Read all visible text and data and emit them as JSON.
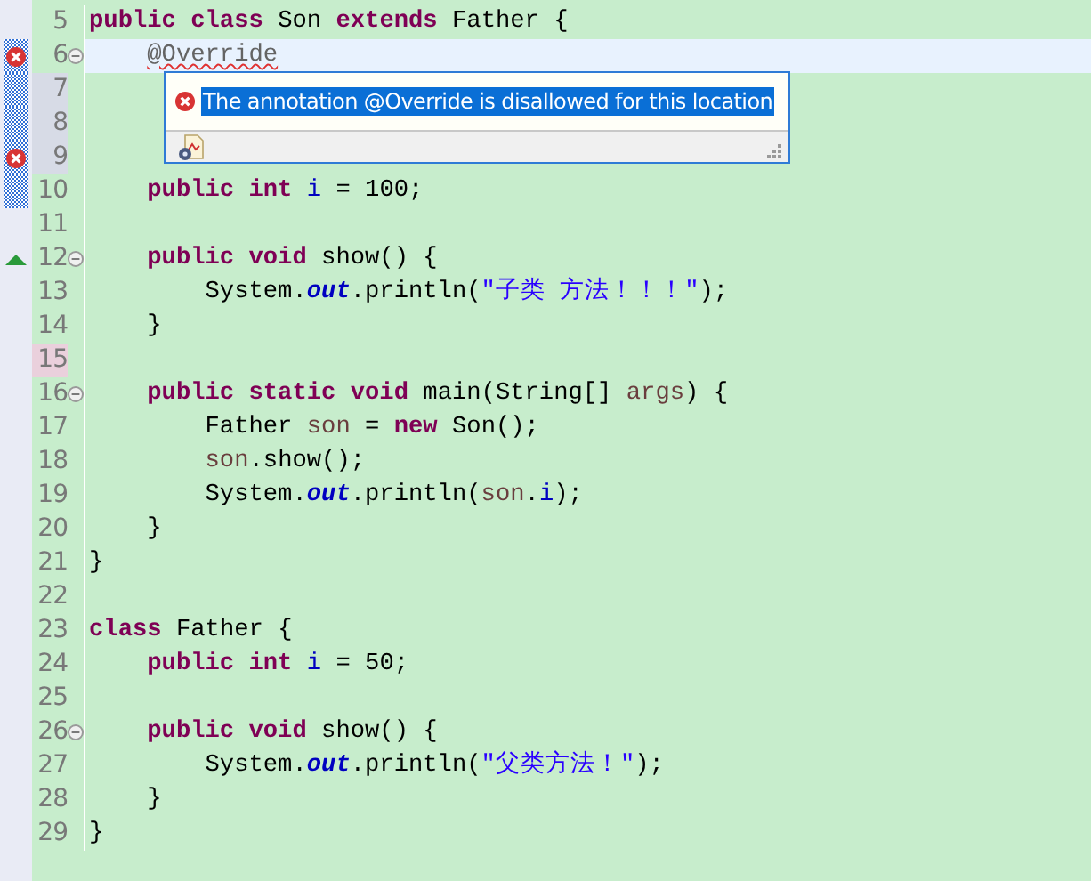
{
  "lines": [
    {
      "number": "5",
      "fold": false,
      "range": false,
      "current": false,
      "error": false,
      "override": false,
      "changed": false,
      "occurrence": false,
      "tokens": [
        {
          "kind": "kw",
          "text": "public class"
        },
        {
          "kind": "plain",
          "text": " Son "
        },
        {
          "kind": "kw",
          "text": "extends"
        },
        {
          "kind": "plain",
          "text": " Father {"
        }
      ]
    },
    {
      "number": "6",
      "fold": true,
      "range": true,
      "current": true,
      "error": true,
      "override": false,
      "changed": false,
      "occurrence": false,
      "tokens": [
        {
          "kind": "error",
          "text": "    @Override"
        }
      ]
    },
    {
      "number": "7",
      "fold": false,
      "range": true,
      "current": false,
      "error": false,
      "override": false,
      "changed": true,
      "occurrence": false
    },
    {
      "number": "8",
      "fold": false,
      "range": true,
      "current": false,
      "error": false,
      "override": false,
      "changed": true,
      "occurrence": false
    },
    {
      "number": "9",
      "fold": false,
      "range": true,
      "current": false,
      "error": true,
      "override": false,
      "changed": true,
      "occurrence": false
    },
    {
      "number": "10",
      "fold": false,
      "range": true,
      "current": false,
      "error": false,
      "override": false,
      "changed": false,
      "occurrence": false,
      "tokens": [
        {
          "kind": "kw",
          "text": "    public int"
        },
        {
          "kind": "field",
          "text": " i"
        },
        {
          "kind": "plain",
          "text": " = 100;"
        }
      ]
    },
    {
      "number": "11",
      "fold": false,
      "range": false,
      "current": false,
      "error": false,
      "override": false,
      "changed": false,
      "occurrence": false
    },
    {
      "number": "12",
      "fold": true,
      "range": false,
      "current": false,
      "error": false,
      "override": true,
      "changed": false,
      "occurrence": false,
      "tokens": [
        {
          "kind": "kw",
          "text": "    public void"
        },
        {
          "kind": "plain",
          "text": " show() {"
        }
      ]
    },
    {
      "number": "13",
      "fold": false,
      "range": false,
      "current": false,
      "error": false,
      "override": false,
      "changed": false,
      "occurrence": false,
      "tokens": [
        {
          "kind": "plain",
          "text": "        System."
        },
        {
          "kind": "static",
          "text": "out"
        },
        {
          "kind": "plain",
          "text": ".println("
        },
        {
          "kind": "str",
          "text": "\"子类 方法！！！\""
        },
        {
          "kind": "plain",
          "text": ");"
        }
      ]
    },
    {
      "number": "14",
      "fold": false,
      "range": false,
      "current": false,
      "error": false,
      "override": false,
      "changed": false,
      "occurrence": false,
      "tokens": [
        {
          "kind": "plain",
          "text": "    }"
        }
      ]
    },
    {
      "number": "15",
      "fold": false,
      "range": false,
      "current": false,
      "error": false,
      "override": false,
      "changed": false,
      "occurrence": true
    },
    {
      "number": "16",
      "fold": true,
      "range": false,
      "current": false,
      "error": false,
      "override": false,
      "changed": false,
      "occurrence": false,
      "tokens": [
        {
          "kind": "kw",
          "text": "    public static void"
        },
        {
          "kind": "plain",
          "text": " main(String[] "
        },
        {
          "kind": "local",
          "text": "args"
        },
        {
          "kind": "plain",
          "text": ") {"
        }
      ]
    },
    {
      "number": "17",
      "fold": false,
      "range": false,
      "current": false,
      "error": false,
      "override": false,
      "changed": false,
      "occurrence": false,
      "tokens": [
        {
          "kind": "plain",
          "text": "        Father "
        },
        {
          "kind": "local",
          "text": "son"
        },
        {
          "kind": "plain",
          "text": " = "
        },
        {
          "kind": "kw",
          "text": "new"
        },
        {
          "kind": "plain",
          "text": " Son();"
        }
      ]
    },
    {
      "number": "18",
      "fold": false,
      "range": false,
      "current": false,
      "error": false,
      "override": false,
      "changed": false,
      "occurrence": false,
      "tokens": [
        {
          "kind": "local",
          "text": "        son"
        },
        {
          "kind": "plain",
          "text": ".show();"
        }
      ]
    },
    {
      "number": "19",
      "fold": false,
      "range": false,
      "current": false,
      "error": false,
      "override": false,
      "changed": false,
      "occurrence": false,
      "tokens": [
        {
          "kind": "plain",
          "text": "        System."
        },
        {
          "kind": "static",
          "text": "out"
        },
        {
          "kind": "plain",
          "text": ".println("
        },
        {
          "kind": "local",
          "text": "son"
        },
        {
          "kind": "plain",
          "text": "."
        },
        {
          "kind": "field",
          "text": "i"
        },
        {
          "kind": "plain",
          "text": ");"
        }
      ]
    },
    {
      "number": "20",
      "fold": false,
      "range": false,
      "current": false,
      "error": false,
      "override": false,
      "changed": false,
      "occurrence": false,
      "tokens": [
        {
          "kind": "plain",
          "text": "    }"
        }
      ]
    },
    {
      "number": "21",
      "fold": false,
      "range": false,
      "current": false,
      "error": false,
      "override": false,
      "changed": false,
      "occurrence": false,
      "tokens": [
        {
          "kind": "plain",
          "text": "}"
        }
      ]
    },
    {
      "number": "22",
      "fold": false,
      "range": false,
      "current": false,
      "error": false,
      "override": false,
      "changed": false,
      "occurrence": false
    },
    {
      "number": "23",
      "fold": false,
      "range": false,
      "current": false,
      "error": false,
      "override": false,
      "changed": false,
      "occurrence": false,
      "tokens": [
        {
          "kind": "kw",
          "text": "class"
        },
        {
          "kind": "plain",
          "text": " Father {"
        }
      ]
    },
    {
      "number": "24",
      "fold": false,
      "range": false,
      "current": false,
      "error": false,
      "override": false,
      "changed": false,
      "occurrence": false,
      "tokens": [
        {
          "kind": "kw",
          "text": "    public int"
        },
        {
          "kind": "field",
          "text": " i"
        },
        {
          "kind": "plain",
          "text": " = 50;"
        }
      ]
    },
    {
      "number": "25",
      "fold": false,
      "range": false,
      "current": false,
      "error": false,
      "override": false,
      "changed": false,
      "occurrence": false
    },
    {
      "number": "26",
      "fold": true,
      "range": false,
      "current": false,
      "error": false,
      "override": false,
      "changed": false,
      "occurrence": false,
      "tokens": [
        {
          "kind": "kw",
          "text": "    public void"
        },
        {
          "kind": "plain",
          "text": " show() {"
        }
      ]
    },
    {
      "number": "27",
      "fold": false,
      "range": false,
      "current": false,
      "error": false,
      "override": false,
      "changed": false,
      "occurrence": false,
      "tokens": [
        {
          "kind": "plain",
          "text": "        System."
        },
        {
          "kind": "static",
          "text": "out"
        },
        {
          "kind": "plain",
          "text": ".println("
        },
        {
          "kind": "str",
          "text": "\"父类方法！\""
        },
        {
          "kind": "plain",
          "text": ");"
        }
      ]
    },
    {
      "number": "28",
      "fold": false,
      "range": false,
      "current": false,
      "error": false,
      "override": false,
      "changed": false,
      "occurrence": false,
      "tokens": [
        {
          "kind": "plain",
          "text": "    }"
        }
      ]
    },
    {
      "number": "29",
      "fold": false,
      "range": false,
      "current": false,
      "error": false,
      "override": false,
      "changed": false,
      "occurrence": false,
      "tokens": [
        {
          "kind": "plain",
          "text": "}"
        }
      ]
    }
  ],
  "popup": {
    "message": "The annotation @Override is disallowed for this location",
    "selected": true
  }
}
